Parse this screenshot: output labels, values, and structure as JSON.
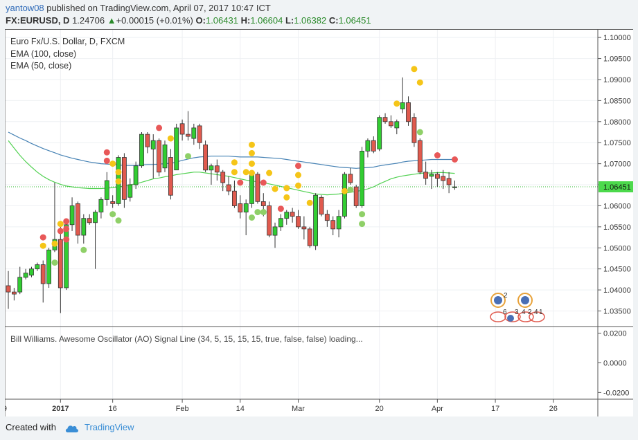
{
  "header": {
    "user": "yantow08",
    "published_text": "published on TradingView.com, April 07, 2017 10:47 ICT",
    "symbol": "FX:EURUSD, D",
    "last": "1.24706",
    "change_arrow": "▲",
    "change": "+0.00015 (+0.01%)",
    "o_label": "O:",
    "o_value": "1.06431",
    "h_label": "H:",
    "h_value": "1.06604",
    "l_label": "L:",
    "l_value": "1.06382",
    "c_label": "C:",
    "c_value": "1.06451"
  },
  "footer": {
    "created_with": "Created with",
    "brand": "TradingView"
  },
  "colors": {
    "up": "#32cd32",
    "down": "#e05a4e",
    "ema100": "#4682b4",
    "ema50": "#52d152",
    "dot_red": "#e85858",
    "dot_yellow": "#f5c518",
    "dot_green": "#8fd068",
    "price_line": "#2fb82f"
  },
  "chart_data": {
    "type": "candlestick",
    "title": "Euro Fx/U.S. Dollar, D, FXCM",
    "indicators": [
      "EMA (100, close)",
      "EMA (50, close)"
    ],
    "y_ticks": [
      "1.10000",
      "1.09500",
      "1.09000",
      "1.08500",
      "1.08000",
      "1.07500",
      "1.07000",
      "1.06500",
      "1.06000",
      "1.05500",
      "1.05000",
      "1.04500",
      "1.04000",
      "1.03500"
    ],
    "ylim": [
      1.0313,
      1.102
    ],
    "last_price": "1.06451",
    "x_ticks": [
      {
        "i": -0.6,
        "label": "9"
      },
      {
        "i": 9,
        "label": "2017"
      },
      {
        "i": 18,
        "label": "16"
      },
      {
        "i": 30,
        "label": "Feb"
      },
      {
        "i": 40,
        "label": "14"
      },
      {
        "i": 50,
        "label": "Mar"
      },
      {
        "i": 64,
        "label": "20"
      },
      {
        "i": 74,
        "label": "Apr"
      },
      {
        "i": 84,
        "label": "17"
      },
      {
        "i": 94,
        "label": "26"
      }
    ],
    "candles": [
      {
        "o": 1.041,
        "h": 1.0445,
        "l": 1.0355,
        "c": 1.0395
      },
      {
        "o": 1.0395,
        "h": 1.0405,
        "l": 1.0375,
        "c": 1.039
      },
      {
        "o": 1.0395,
        "h": 1.0455,
        "l": 1.039,
        "c": 1.043
      },
      {
        "o": 1.043,
        "h": 1.045,
        "l": 1.0425,
        "c": 1.044
      },
      {
        "o": 1.0435,
        "h": 1.0455,
        "l": 1.043,
        "c": 1.045
      },
      {
        "o": 1.045,
        "h": 1.0465,
        "l": 1.0445,
        "c": 1.046
      },
      {
        "o": 1.046,
        "h": 1.047,
        "l": 1.037,
        "c": 1.0415
      },
      {
        "o": 1.0415,
        "h": 1.05,
        "l": 1.0405,
        "c": 1.0495
      },
      {
        "o": 1.0495,
        "h": 1.0655,
        "l": 1.049,
        "c": 1.052
      },
      {
        "o": 1.052,
        "h": 1.056,
        "l": 1.0345,
        "c": 1.0405
      },
      {
        "o": 1.0405,
        "h": 1.057,
        "l": 1.04,
        "c": 1.0555
      },
      {
        "o": 1.0555,
        "h": 1.062,
        "l": 1.054,
        "c": 1.06
      },
      {
        "o": 1.0605,
        "h": 1.061,
        "l": 1.051,
        "c": 1.053
      },
      {
        "o": 1.053,
        "h": 1.058,
        "l": 1.051,
        "c": 1.057
      },
      {
        "o": 1.057,
        "h": 1.058,
        "l": 1.0555,
        "c": 1.056
      },
      {
        "o": 1.056,
        "h": 1.059,
        "l": 1.045,
        "c": 1.0585
      },
      {
        "o": 1.0585,
        "h": 1.062,
        "l": 1.057,
        "c": 1.0615
      },
      {
        "o": 1.0615,
        "h": 1.068,
        "l": 1.06,
        "c": 1.066
      },
      {
        "o": 1.061,
        "h": 1.0625,
        "l": 1.0595,
        "c": 1.0605
      },
      {
        "o": 1.0605,
        "h": 1.072,
        "l": 1.06,
        "c": 1.0715
      },
      {
        "o": 1.0715,
        "h": 1.0725,
        "l": 1.0595,
        "c": 1.0615
      },
      {
        "o": 1.062,
        "h": 1.0665,
        "l": 1.061,
        "c": 1.065
      },
      {
        "o": 1.065,
        "h": 1.0705,
        "l": 1.064,
        "c": 1.0695
      },
      {
        "o": 1.0695,
        "h": 1.0775,
        "l": 1.069,
        "c": 1.077
      },
      {
        "o": 1.077,
        "h": 1.0775,
        "l": 1.0725,
        "c": 1.074
      },
      {
        "o": 1.0735,
        "h": 1.077,
        "l": 1.0665,
        "c": 1.0755
      },
      {
        "o": 1.0755,
        "h": 1.076,
        "l": 1.067,
        "c": 1.068
      },
      {
        "o": 1.069,
        "h": 1.0755,
        "l": 1.068,
        "c": 1.0745
      },
      {
        "o": 1.0715,
        "h": 1.0735,
        "l": 1.0615,
        "c": 1.0625
      },
      {
        "o": 1.0685,
        "h": 1.0795,
        "l": 1.0685,
        "c": 1.0785
      },
      {
        "o": 1.0795,
        "h": 1.0805,
        "l": 1.0755,
        "c": 1.077
      },
      {
        "o": 1.077,
        "h": 1.0825,
        "l": 1.0755,
        "c": 1.0765
      },
      {
        "o": 1.076,
        "h": 1.0795,
        "l": 1.0745,
        "c": 1.0785
      },
      {
        "o": 1.079,
        "h": 1.0795,
        "l": 1.0735,
        "c": 1.075
      },
      {
        "o": 1.0745,
        "h": 1.0755,
        "l": 1.068,
        "c": 1.0685
      },
      {
        "o": 1.0685,
        "h": 1.07,
        "l": 1.065,
        "c": 1.0695
      },
      {
        "o": 1.0695,
        "h": 1.071,
        "l": 1.066,
        "c": 1.068
      },
      {
        "o": 1.068,
        "h": 1.0685,
        "l": 1.0635,
        "c": 1.0655
      },
      {
        "o": 1.065,
        "h": 1.067,
        "l": 1.0625,
        "c": 1.0635
      },
      {
        "o": 1.0635,
        "h": 1.066,
        "l": 1.0595,
        "c": 1.06
      },
      {
        "o": 1.0605,
        "h": 1.0625,
        "l": 1.057,
        "c": 1.0585
      },
      {
        "o": 1.0585,
        "h": 1.0615,
        "l": 1.053,
        "c": 1.0605
      },
      {
        "o": 1.0605,
        "h": 1.068,
        "l": 1.0595,
        "c": 1.0675
      },
      {
        "o": 1.0675,
        "h": 1.068,
        "l": 1.0605,
        "c": 1.061
      },
      {
        "o": 1.061,
        "h": 1.063,
        "l": 1.0575,
        "c": 1.06
      },
      {
        "o": 1.06,
        "h": 1.061,
        "l": 1.0525,
        "c": 1.053
      },
      {
        "o": 1.053,
        "h": 1.056,
        "l": 1.05,
        "c": 1.055
      },
      {
        "o": 1.055,
        "h": 1.058,
        "l": 1.054,
        "c": 1.057
      },
      {
        "o": 1.057,
        "h": 1.059,
        "l": 1.0555,
        "c": 1.0585
      },
      {
        "o": 1.0585,
        "h": 1.0595,
        "l": 1.056,
        "c": 1.0575
      },
      {
        "o": 1.0575,
        "h": 1.059,
        "l": 1.0545,
        "c": 1.055
      },
      {
        "o": 1.055,
        "h": 1.0575,
        "l": 1.052,
        "c": 1.0545
      },
      {
        "o": 1.0545,
        "h": 1.055,
        "l": 1.05,
        "c": 1.0505
      },
      {
        "o": 1.0505,
        "h": 1.063,
        "l": 1.0495,
        "c": 1.0625
      },
      {
        "o": 1.062,
        "h": 1.0625,
        "l": 1.0575,
        "c": 1.058
      },
      {
        "o": 1.058,
        "h": 1.059,
        "l": 1.055,
        "c": 1.0565
      },
      {
        "o": 1.0565,
        "h": 1.0575,
        "l": 1.053,
        "c": 1.0545
      },
      {
        "o": 1.0545,
        "h": 1.059,
        "l": 1.0525,
        "c": 1.0575
      },
      {
        "o": 1.0575,
        "h": 1.068,
        "l": 1.057,
        "c": 1.0675
      },
      {
        "o": 1.0675,
        "h": 1.069,
        "l": 1.065,
        "c": 1.0655
      },
      {
        "o": 1.0645,
        "h": 1.065,
        "l": 1.0595,
        "c": 1.06
      },
      {
        "o": 1.06,
        "h": 1.074,
        "l": 1.0595,
        "c": 1.073
      },
      {
        "o": 1.073,
        "h": 1.076,
        "l": 1.0715,
        "c": 1.0755
      },
      {
        "o": 1.0755,
        "h": 1.0765,
        "l": 1.0725,
        "c": 1.073
      },
      {
        "o": 1.0735,
        "h": 1.0815,
        "l": 1.073,
        "c": 1.081
      },
      {
        "o": 1.081,
        "h": 1.082,
        "l": 1.0795,
        "c": 1.08
      },
      {
        "o": 1.08,
        "h": 1.0815,
        "l": 1.0785,
        "c": 1.079
      },
      {
        "o": 1.0785,
        "h": 1.0805,
        "l": 1.077,
        "c": 1.08
      },
      {
        "o": 1.083,
        "h": 1.0905,
        "l": 1.082,
        "c": 1.0845
      },
      {
        "o": 1.0845,
        "h": 1.086,
        "l": 1.079,
        "c": 1.08
      },
      {
        "o": 1.081,
        "h": 1.082,
        "l": 1.074,
        "c": 1.075
      },
      {
        "o": 1.0755,
        "h": 1.076,
        "l": 1.0675,
        "c": 1.068
      },
      {
        "o": 1.068,
        "h": 1.0705,
        "l": 1.065,
        "c": 1.0665
      },
      {
        "o": 1.067,
        "h": 1.0685,
        "l": 1.064,
        "c": 1.0675
      },
      {
        "o": 1.0675,
        "h": 1.068,
        "l": 1.0645,
        "c": 1.0665
      },
      {
        "o": 1.067,
        "h": 1.0685,
        "l": 1.064,
        "c": 1.066
      },
      {
        "o": 1.0665,
        "h": 1.068,
        "l": 1.063,
        "c": 1.065
      },
      {
        "o": 1.0643,
        "h": 1.066,
        "l": 1.0638,
        "c": 1.0645
      }
    ],
    "ema100": [
      1.0775,
      1.0768,
      1.0761,
      1.0755,
      1.0748,
      1.0742,
      1.0736,
      1.0731,
      1.0726,
      1.0721,
      1.0717,
      1.0713,
      1.071,
      1.0707,
      1.0704,
      1.0702,
      1.07,
      1.0699,
      1.0698,
      1.0697,
      1.0696,
      1.0696,
      1.0696,
      1.0697,
      1.0698,
      1.0698,
      1.0699,
      1.07,
      1.0701,
      1.0704,
      1.0708,
      1.0711,
      1.0714,
      1.0716,
      1.0717,
      1.0718,
      1.0718,
      1.0718,
      1.0718,
      1.0717,
      1.0716,
      1.0716,
      1.0716,
      1.0716,
      1.0715,
      1.0714,
      1.0713,
      1.0712,
      1.071,
      1.0708,
      1.0706,
      1.0704,
      1.0702,
      1.07,
      1.0698,
      1.0696,
      1.0694,
      1.0692,
      1.0691,
      1.069,
      1.0689,
      1.069,
      1.0691,
      1.0692,
      1.0695,
      1.0697,
      1.0699,
      1.0701,
      1.0704,
      1.0706,
      1.0707,
      1.0708,
      1.0709,
      1.071,
      1.071,
      1.071,
      1.071,
      1.071
    ],
    "ema50": [
      1.0755,
      1.0737,
      1.072,
      1.0705,
      1.0692,
      1.068,
      1.067,
      1.0662,
      1.0656,
      1.0651,
      1.0647,
      1.0645,
      1.0643,
      1.0642,
      1.0641,
      1.0641,
      1.0641,
      1.0642,
      1.0643,
      1.0645,
      1.0647,
      1.065,
      1.0652,
      1.0656,
      1.066,
      1.0664,
      1.0666,
      1.0669,
      1.0671,
      1.0674,
      1.0676,
      1.0678,
      1.068,
      1.068,
      1.0678,
      1.0676,
      1.0674,
      1.0672,
      1.067,
      1.0667,
      1.0664,
      1.0661,
      1.0659,
      1.0657,
      1.0655,
      1.0652,
      1.0649,
      1.0646,
      1.0643,
      1.064,
      1.0637,
      1.0634,
      1.0631,
      1.0628,
      1.0627,
      1.0626,
      1.0627,
      1.0628,
      1.063,
      1.0632,
      1.0634,
      1.0637,
      1.064,
      1.0645,
      1.0652,
      1.0658,
      1.0664,
      1.0668,
      1.0671,
      1.0673,
      1.0675,
      1.0677,
      1.0678,
      1.0678,
      1.0679,
      1.0679,
      1.0678,
      1.0677
    ],
    "signal_dots": [
      {
        "i": 6,
        "v": 1.0525,
        "c": "red"
      },
      {
        "i": 6,
        "v": 1.0505,
        "c": "yellow"
      },
      {
        "i": 8,
        "v": 1.0465,
        "c": "green"
      },
      {
        "i": 8,
        "v": 1.051,
        "c": "yellow"
      },
      {
        "i": 9,
        "v": 1.054,
        "c": "red"
      },
      {
        "i": 9,
        "v": 1.0557,
        "c": "yellow"
      },
      {
        "i": 10,
        "v": 1.0545,
        "c": "red"
      },
      {
        "i": 10,
        "v": 1.0563,
        "c": "red"
      },
      {
        "i": 10,
        "v": 1.052,
        "c": "red"
      },
      {
        "i": 13,
        "v": 1.0495,
        "c": "green"
      },
      {
        "i": 17,
        "v": 1.0727,
        "c": "red"
      },
      {
        "i": 17,
        "v": 1.0707,
        "c": "red"
      },
      {
        "i": 18,
        "v": 1.058,
        "c": "green"
      },
      {
        "i": 18,
        "v": 1.07,
        "c": "yellow"
      },
      {
        "i": 19,
        "v": 1.0565,
        "c": "green"
      },
      {
        "i": 19,
        "v": 1.068,
        "c": "yellow"
      },
      {
        "i": 19,
        "v": 1.0658,
        "c": "yellow"
      },
      {
        "i": 26,
        "v": 1.0785,
        "c": "red"
      },
      {
        "i": 28,
        "v": 1.076,
        "c": "yellow"
      },
      {
        "i": 31,
        "v": 1.0718,
        "c": "green"
      },
      {
        "i": 39,
        "v": 1.0703,
        "c": "yellow"
      },
      {
        "i": 39,
        "v": 1.068,
        "c": "yellow"
      },
      {
        "i": 40,
        "v": 1.0655,
        "c": "red"
      },
      {
        "i": 41,
        "v": 1.068,
        "c": "yellow"
      },
      {
        "i": 42,
        "v": 1.0745,
        "c": "yellow"
      },
      {
        "i": 42,
        "v": 1.0725,
        "c": "yellow"
      },
      {
        "i": 42,
        "v": 1.07,
        "c": "yellow"
      },
      {
        "i": 42,
        "v": 1.0678,
        "c": "yellow"
      },
      {
        "i": 42,
        "v": 1.0572,
        "c": "green"
      },
      {
        "i": 43,
        "v": 1.0585,
        "c": "green"
      },
      {
        "i": 44,
        "v": 1.0585,
        "c": "green"
      },
      {
        "i": 44,
        "v": 1.0655,
        "c": "red"
      },
      {
        "i": 45,
        "v": 1.0678,
        "c": "yellow"
      },
      {
        "i": 46,
        "v": 1.064,
        "c": "yellow"
      },
      {
        "i": 47,
        "v": 1.0593,
        "c": "red"
      },
      {
        "i": 48,
        "v": 1.0642,
        "c": "yellow"
      },
      {
        "i": 48,
        "v": 1.062,
        "c": "yellow"
      },
      {
        "i": 50,
        "v": 1.0695,
        "c": "red"
      },
      {
        "i": 50,
        "v": 1.0673,
        "c": "yellow"
      },
      {
        "i": 50,
        "v": 1.0648,
        "c": "yellow"
      },
      {
        "i": 52,
        "v": 1.0607,
        "c": "yellow"
      },
      {
        "i": 58,
        "v": 1.0635,
        "c": "yellow"
      },
      {
        "i": 59,
        "v": 1.0638,
        "c": "green"
      },
      {
        "i": 61,
        "v": 1.058,
        "c": "green"
      },
      {
        "i": 61,
        "v": 1.0557,
        "c": "green"
      },
      {
        "i": 67,
        "v": 1.0843,
        "c": "yellow"
      },
      {
        "i": 70,
        "v": 1.0925,
        "c": "yellow"
      },
      {
        "i": 71,
        "v": 1.0893,
        "c": "yellow"
      },
      {
        "i": 71,
        "v": 1.0775,
        "c": "green"
      },
      {
        "i": 74,
        "v": 1.072,
        "c": "red"
      },
      {
        "i": 77,
        "v": 1.071,
        "c": "red"
      }
    ],
    "ao_pane": {
      "title": "Bill Williams. Awesome Oscillator (AO) Signal Line (34, 5, 15, 15, 15, true, false, false) loading...",
      "y_ticks": [
        "0.0200",
        "0.0000",
        "-0.0200"
      ],
      "ylim": [
        -0.0245,
        0.0245
      ]
    },
    "event_markers": {
      "label1": "2",
      "label2": "6",
      "label3": "3",
      "label4": "4",
      "label5": "2",
      "label6": "4",
      "label7": "1"
    }
  }
}
